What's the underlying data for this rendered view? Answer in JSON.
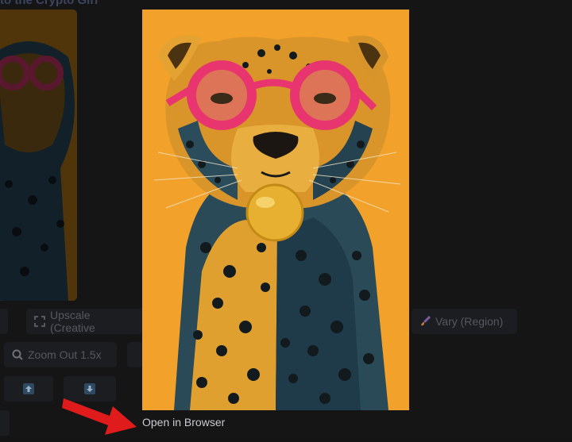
{
  "background": {
    "title": "to the Crypto Girl",
    "buttons": {
      "upscale_creative": "Upscale (Creative",
      "vary_region": "Vary (Region)",
      "zoom_out": "Zoom Out 1.5x"
    },
    "icons": {
      "upscale": "expand-icon",
      "vary_region": "brush-icon",
      "zoom_out": "magnifier-icon",
      "pan_up": "arrow-up-icon",
      "pan_down": "arrow-down-icon"
    }
  },
  "modal": {
    "image_subject": "leopard-with-pink-glasses-and-bubblegum",
    "open_in_browser": "Open in Browser"
  },
  "colors": {
    "image_bg": "#f2a12a",
    "annotation_arrow": "#e01b1b",
    "link": "#c9cbd0"
  }
}
